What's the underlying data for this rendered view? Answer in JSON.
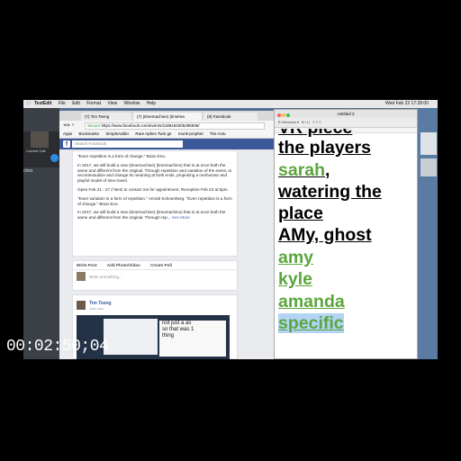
{
  "menubar": {
    "app": "TextEdit",
    "items": [
      "File",
      "Edit",
      "Format",
      "View",
      "Window",
      "Help"
    ],
    "clock": "Wed Feb 22  17:28:00"
  },
  "call": {
    "name": "Current Call",
    "label": "ches"
  },
  "browser": {
    "tabs": [
      "(7) Tim Tseng",
      "(7) (timemachine) (timema",
      "(8) Facebook"
    ],
    "secure_label": "Secure",
    "url": "https://www.facebook.com/events/1189163305296936/",
    "bookmarks": [
      "Apps",
      "Bookmarks",
      "SimpleAdder",
      "Rare Aphex Twin ge",
      "monk-prophet",
      "The Actu"
    ],
    "search_placeholder": "Search Facebook"
  },
  "event_post": {
    "p1": "\"Even repetition is a form of change.\" Brian Eno.",
    "p2": "In 2017, we will build a new (timemachine) (timemachine) that is at once both the same and different from the original. Through repetition and variation of the event, to recontextualize and change its meaning at both ends, proposing a nonhuman and playful model of time travel.",
    "p3": "Open Feb 21 - 27 // Best to contact me for appointment. Reception Feb 23 at 8pm.",
    "p4": "\"Even variation is a form of repetition.\" Arnold Schoenberg. \"Even repetition is a form of change.\" Brian Eno.",
    "p5": "In 2017, we will build a new (timemachine) (timemachine) that is at once both the same and different from the original. Through rep...",
    "see_more": "See More"
  },
  "composer": {
    "write_post": "Write Post",
    "add_photo": "Add Photo/Video",
    "create_poll": "Create Poll",
    "placeholder": "Write something..."
  },
  "feed_post": {
    "author": "Tim Tseng",
    "time": "Just now",
    "snippet": [
      "not just a as",
      "so that was 1",
      "thing"
    ]
  },
  "textedit": {
    "title": "Untitled 2",
    "lines": [
      {
        "text": "VR piece",
        "style": "black"
      },
      {
        "text": "the players",
        "style": "black"
      },
      {
        "text": "sarah",
        "style": "green",
        "suffix": ","
      },
      {
        "text": "watering the",
        "style": "black"
      },
      {
        "text": "place",
        "style": "black"
      },
      {
        "text": "AMy, ghost",
        "style": "black"
      },
      {
        "text": "amy",
        "style": "green"
      },
      {
        "text": "kyle",
        "style": "green"
      },
      {
        "text": "amanda",
        "style": "green"
      },
      {
        "text": "specific",
        "style": "green-selected"
      }
    ],
    "colors": {
      "green": "#5aa63c",
      "selection": "#b3d4f5"
    }
  },
  "timecode": "00:02:50;04"
}
